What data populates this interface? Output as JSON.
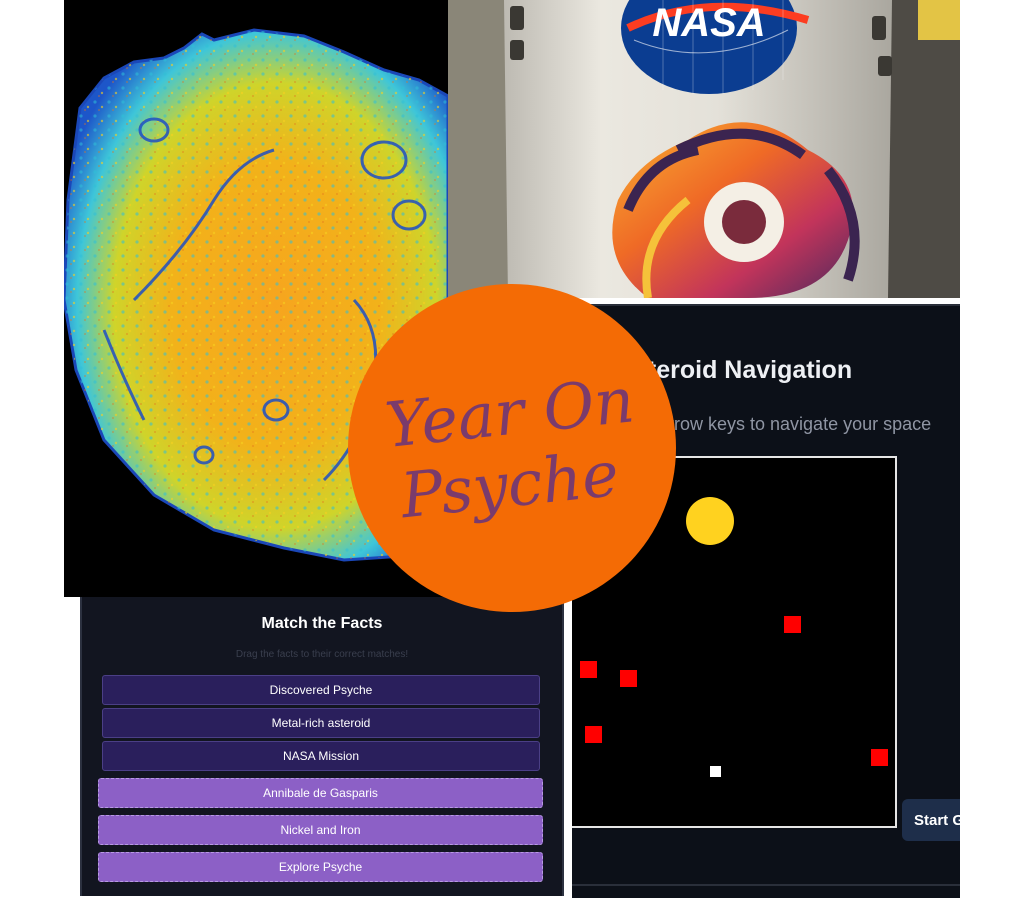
{
  "badge": {
    "title_line1": "Year On",
    "title_line2": "Psyche",
    "color": "#f46b05",
    "text_color": "#7a3b6c"
  },
  "fairing": {
    "agency_logo_text": "NASA"
  },
  "navigation_game": {
    "title": "Asteroid Navigation",
    "visible_title": "steroid Navigation",
    "instructions": "rrow keys to navigate your space",
    "start_button_label": "Start G",
    "obstacle_color": "#ff0000",
    "target_color": "#ffd21f",
    "ship_color": "#ffffff"
  },
  "match_game": {
    "title": "Match the Facts",
    "subtitle": "Drag the facts to their correct matches!",
    "facts": [
      "Discovered Psyche",
      "Metal-rich asteroid",
      "NASA Mission"
    ],
    "answers": [
      "Annibale de Gasparis",
      "Nickel and Iron",
      "Explore Psyche"
    ]
  }
}
